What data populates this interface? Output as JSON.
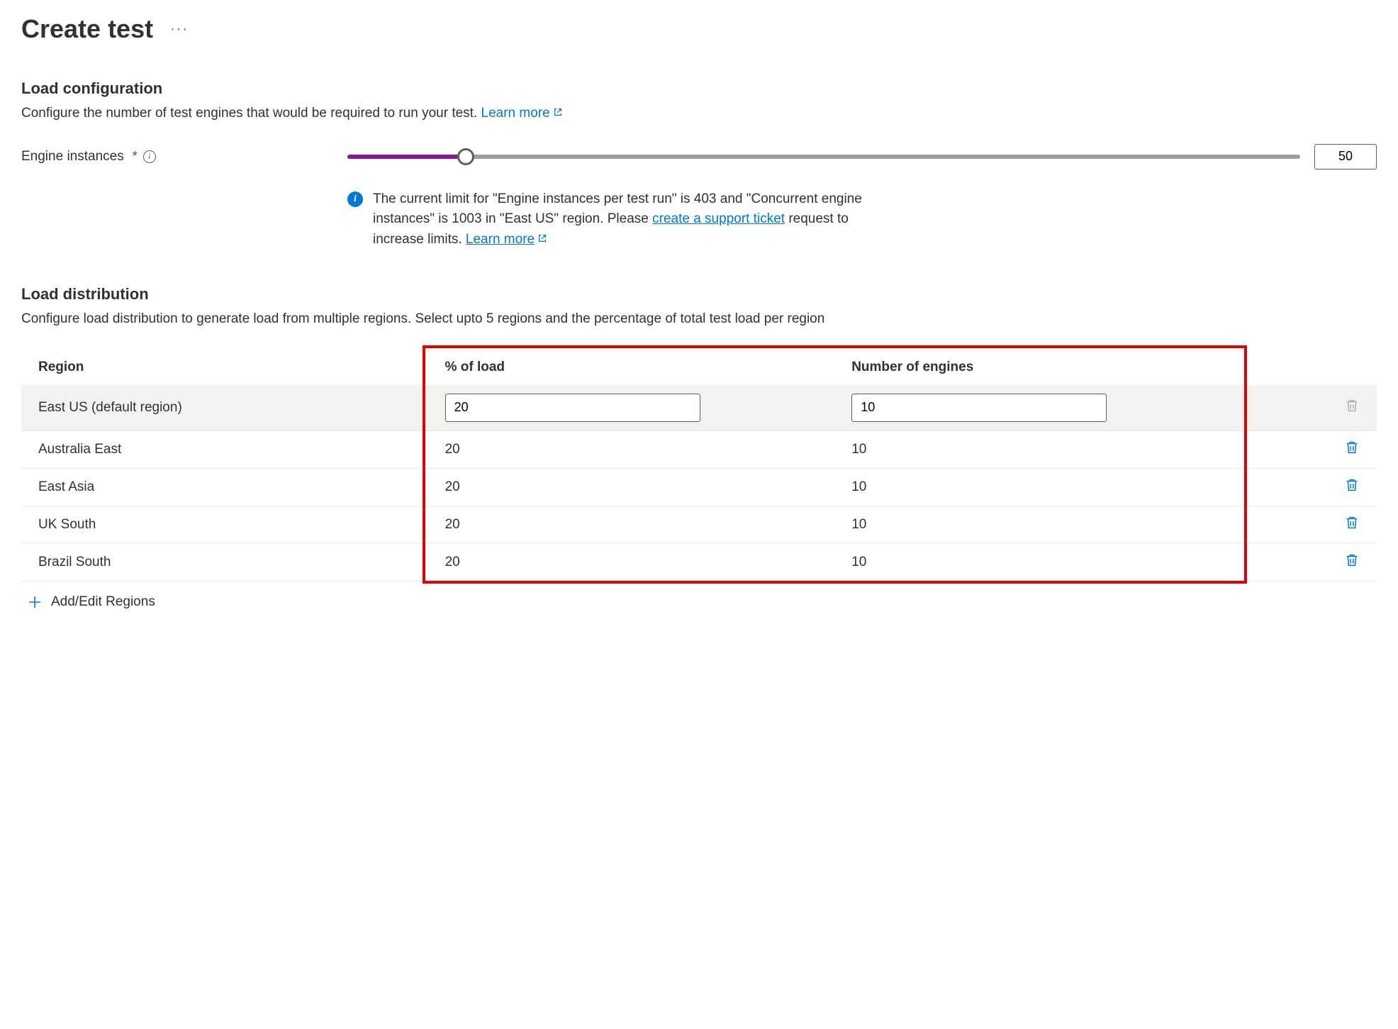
{
  "page": {
    "title": "Create test",
    "more_actions": "···"
  },
  "load_config": {
    "heading": "Load configuration",
    "description": "Configure the number of test engines that would be required to run your test. ",
    "learn_more": "Learn more",
    "slider_label": "Engine instances",
    "slider_value": "50",
    "info_text_part1": "The current limit for \"Engine instances per test run\" is 403 and \"Concurrent engine instances\" is 1003 in \"East US\" region. Please ",
    "info_link1": "create a support ticket",
    "info_text_part2": " request to increase limits. ",
    "info_link2": "Learn more"
  },
  "load_dist": {
    "heading": "Load distribution",
    "description": "Configure load distribution to generate load from multiple regions. Select upto 5 regions and the percentage of total test load per region",
    "columns": {
      "region": "Region",
      "pct_load": "% of load",
      "num_engines": "Number of engines"
    },
    "rows": [
      {
        "region": "East US (default region)",
        "pct_load": "20",
        "num_engines": "10",
        "editable": true,
        "deletable": false
      },
      {
        "region": "Australia East",
        "pct_load": "20",
        "num_engines": "10",
        "editable": false,
        "deletable": true
      },
      {
        "region": "East Asia",
        "pct_load": "20",
        "num_engines": "10",
        "editable": false,
        "deletable": true
      },
      {
        "region": "UK South",
        "pct_load": "20",
        "num_engines": "10",
        "editable": false,
        "deletable": true
      },
      {
        "region": "Brazil South",
        "pct_load": "20",
        "num_engines": "10",
        "editable": false,
        "deletable": true
      }
    ],
    "add_edit_label": "Add/Edit Regions"
  }
}
